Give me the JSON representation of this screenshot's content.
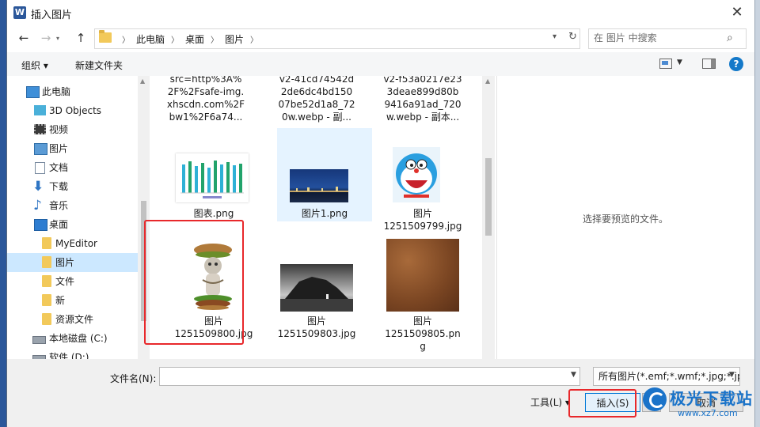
{
  "dialog": {
    "app_logo": "W",
    "title": "插入图片",
    "close_symbol": "✕"
  },
  "nav": {
    "back": "←",
    "forward": "→",
    "up": "↑",
    "breadcrumb": [
      "此电脑",
      "桌面",
      "图片"
    ],
    "search_placeholder": "在 图片 中搜索"
  },
  "toolbar": {
    "organize": "组织 ▾",
    "new_folder": "新建文件夹",
    "help": "?"
  },
  "sidebar": {
    "items": [
      {
        "label": "此电脑",
        "icon": "computer-icon"
      },
      {
        "label": "3D Objects",
        "icon": "3d-objects-icon"
      },
      {
        "label": "视频",
        "icon": "video-icon"
      },
      {
        "label": "图片",
        "icon": "pictures-icon"
      },
      {
        "label": "文档",
        "icon": "documents-icon"
      },
      {
        "label": "下载",
        "icon": "download-icon"
      },
      {
        "label": "音乐",
        "icon": "music-icon"
      },
      {
        "label": "桌面",
        "icon": "desktop-icon"
      },
      {
        "label": "MyEditor",
        "icon": "folder-icon"
      },
      {
        "label": "图片",
        "icon": "folder-icon"
      },
      {
        "label": "文件",
        "icon": "folder-icon"
      },
      {
        "label": "新",
        "icon": "folder-icon"
      },
      {
        "label": "资源文件",
        "icon": "folder-icon"
      },
      {
        "label": "本地磁盘 (C:)",
        "icon": "disk-icon"
      },
      {
        "label": "软件 (D:)",
        "icon": "disk-icon"
      }
    ],
    "selected_index": 9
  },
  "files": {
    "top_partial": [
      {
        "lines": [
          "src=http%3A%",
          "2F%2Fsafe-img.",
          "xhscdn.com%2F",
          "bw1%2F6a74..."
        ]
      },
      {
        "lines": [
          "v2-41cd74542d",
          "2de6dc4bd150",
          "07be52d1a8_72",
          "0w.webp - 副..."
        ]
      },
      {
        "lines": [
          "v2-f53a0217e23",
          "3deae899d80b",
          "9416a91ad_720",
          "w.webp - 副本..."
        ]
      }
    ],
    "row2": [
      {
        "lines": [
          "图表.png"
        ],
        "thumb": "bar-chart"
      },
      {
        "lines": [
          "图片1.png"
        ],
        "thumb": "night-city"
      },
      {
        "lines": [
          "图片",
          "1251509799.jpg"
        ],
        "thumb": "cartoon-cat"
      }
    ],
    "row3": [
      {
        "lines": [
          "图片",
          "1251509800.jpg"
        ],
        "thumb": "cat-burger"
      },
      {
        "lines": [
          "图片",
          "1251509803.jpg"
        ],
        "thumb": "rock-bw"
      },
      {
        "lines": [
          "图片",
          "1251509805.pn",
          "g"
        ],
        "thumb": "leather"
      }
    ]
  },
  "preview": {
    "message": "选择要预览的文件。"
  },
  "bottom": {
    "filename_label": "文件名(N):",
    "filename_value": "",
    "filetype": "所有图片(*.emf;*.wmf;*.jpg;*.jp",
    "tools": "工具(L) ▾",
    "insert": "插入(S)",
    "cancel": "取消"
  },
  "watermark": {
    "title": "极光下载站",
    "url": "www.xz7.com"
  },
  "colors": {
    "highlight": "#e8282b",
    "selection": "#cce8ff",
    "accent": "#0078d7"
  }
}
